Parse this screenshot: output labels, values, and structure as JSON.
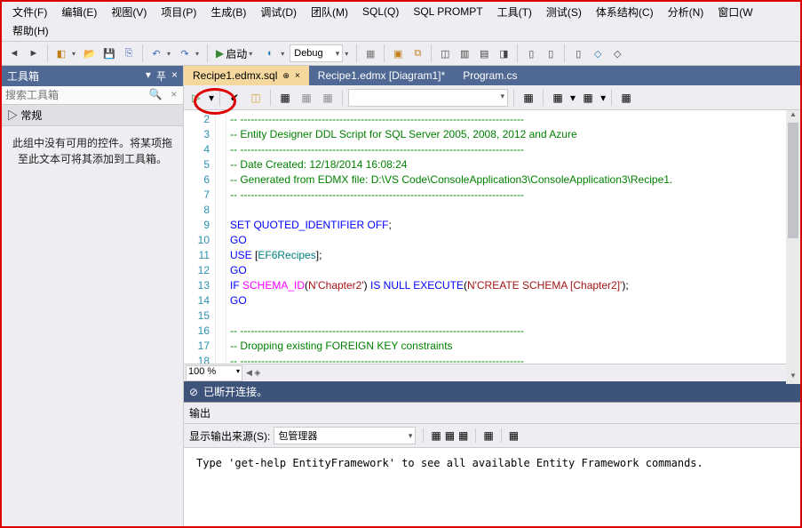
{
  "menu": [
    "文件(F)",
    "编辑(E)",
    "视图(V)",
    "项目(P)",
    "生成(B)",
    "调试(D)",
    "团队(M)",
    "SQL(Q)",
    "SQL PROMPT",
    "工具(T)",
    "测试(S)",
    "体系结构(C)",
    "分析(N)",
    "窗口(W"
  ],
  "menu2": "帮助(H)",
  "toolbar": {
    "start": "启动",
    "config": "Debug"
  },
  "sidebar": {
    "title": "工具箱",
    "search_placeholder": "搜索工具箱",
    "category": "▷ 常规",
    "empty": "此组中没有可用的控件。将某项拖至此文本可将其添加到工具箱。"
  },
  "tabs": [
    {
      "label": "Recipe1.edmx.sql",
      "active": true,
      "pin": true
    },
    {
      "label": "Recipe1.edmx [Diagram1]*",
      "active": false
    },
    {
      "label": "Program.cs",
      "active": false
    }
  ],
  "code": {
    "lines": [
      {
        "n": 2,
        "t": "comment",
        "text": "-- --------------------------------------------------------------------------------"
      },
      {
        "n": 3,
        "t": "comment",
        "text": "-- Entity Designer DDL Script for SQL Server 2005, 2008, 2012 and Azure"
      },
      {
        "n": 4,
        "t": "comment",
        "text": "-- --------------------------------------------------------------------------------"
      },
      {
        "n": 5,
        "t": "comment",
        "text": "-- Date Created: 12/18/2014 16:08:24"
      },
      {
        "n": 6,
        "t": "comment",
        "text": "-- Generated from EDMX file: D:\\VS Code\\ConsoleApplication3\\ConsoleApplication3\\Recipe1."
      },
      {
        "n": 7,
        "t": "comment",
        "text": "-- --------------------------------------------------------------------------------"
      },
      {
        "n": 8,
        "t": "blank",
        "text": ""
      },
      {
        "n": 9,
        "t": "sql1"
      },
      {
        "n": 10,
        "t": "go"
      },
      {
        "n": 11,
        "t": "sql2"
      },
      {
        "n": 12,
        "t": "go"
      },
      {
        "n": 13,
        "t": "sql3"
      },
      {
        "n": 14,
        "t": "go"
      },
      {
        "n": 15,
        "t": "blank",
        "text": ""
      },
      {
        "n": 16,
        "t": "comment",
        "text": "-- --------------------------------------------------------------------------------"
      },
      {
        "n": 17,
        "t": "comment",
        "text": "-- Dropping existing FOREIGN KEY constraints"
      },
      {
        "n": 18,
        "t": "comment",
        "text": "-- --------------------------------------------------------------------------------"
      }
    ]
  },
  "zoom": "100 %",
  "status": "已断开连接。",
  "output": {
    "title": "输出",
    "from_label": "显示输出来源(S):",
    "source": "包管理器",
    "body": "Type 'get-help EntityFramework' to see all available Entity Framework commands."
  }
}
